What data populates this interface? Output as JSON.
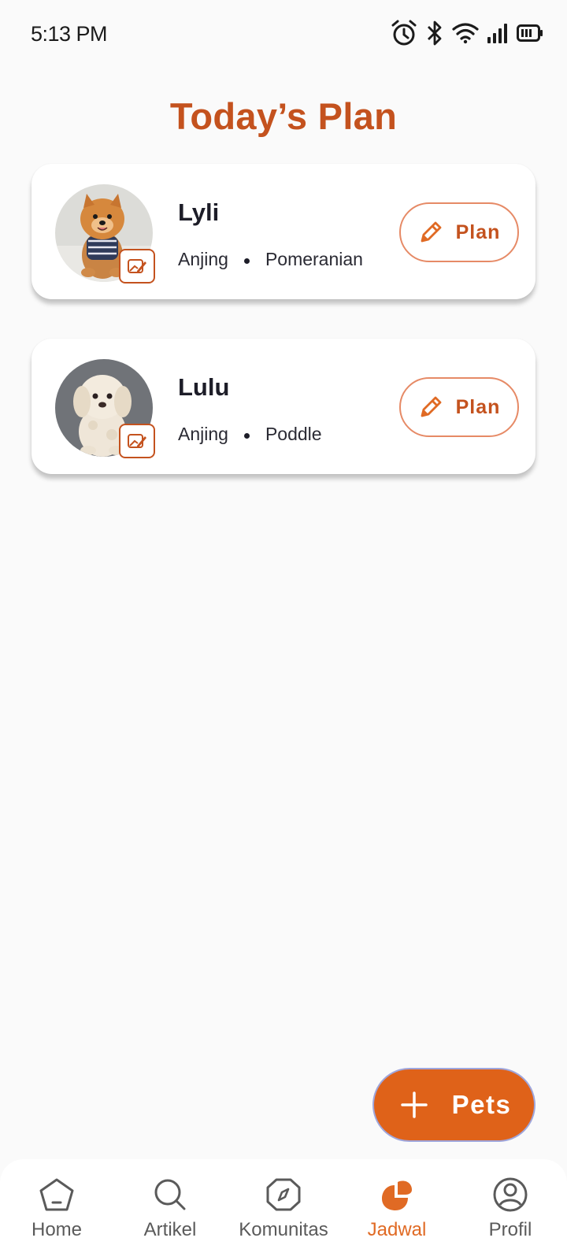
{
  "status_bar": {
    "time": "5:13 PM"
  },
  "page": {
    "title": "Today’s Plan"
  },
  "pets": [
    {
      "name": "Lyli",
      "species": "Anjing",
      "breed": "Pomeranian",
      "plan_label": "Plan"
    },
    {
      "name": "Lulu",
      "species": "Anjing",
      "breed": "Poddle",
      "plan_label": "Plan"
    }
  ],
  "fab": {
    "label": "Pets"
  },
  "nav": {
    "items": [
      {
        "label": "Home",
        "icon": "pentagon-home-icon"
      },
      {
        "label": "Artikel",
        "icon": "search-icon"
      },
      {
        "label": "Komunitas",
        "icon": "compass-icon"
      },
      {
        "label": "Jadwal",
        "icon": "schedule-blob-icon",
        "active": true
      },
      {
        "label": "Profil",
        "icon": "user-circle-icon"
      }
    ]
  },
  "colors": {
    "accent": "#c4521e",
    "fab": "#df6219",
    "active_nav": "#e06a24"
  }
}
